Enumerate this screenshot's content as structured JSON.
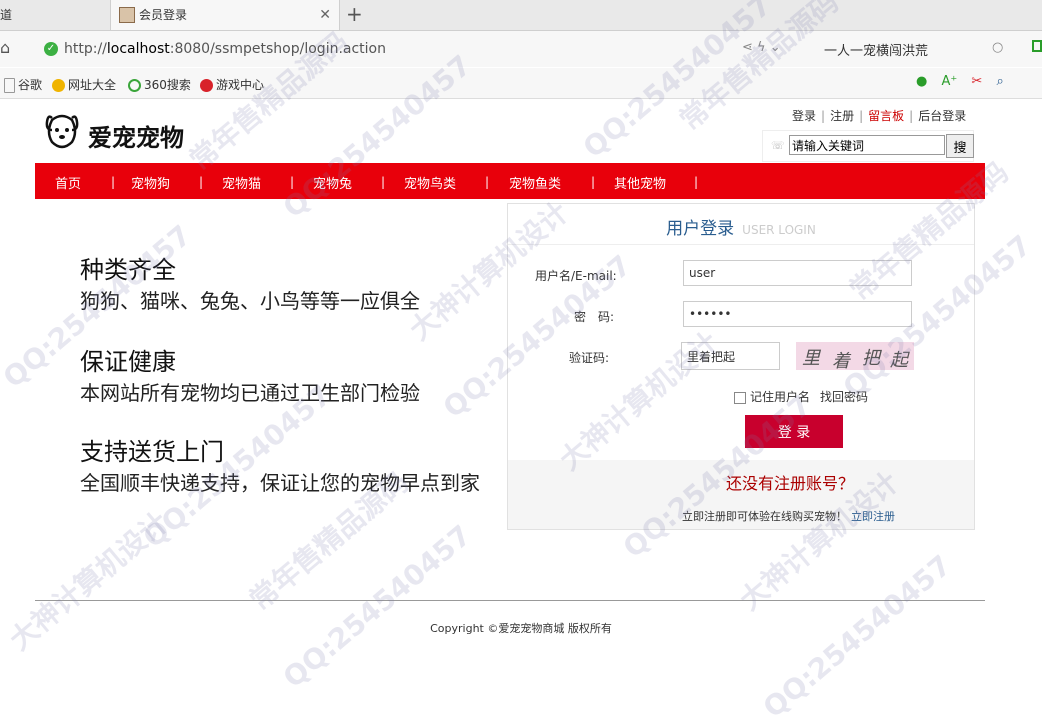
{
  "browser": {
    "prev_tab_label": "道",
    "active_tab_label": "会员登录",
    "url_prefix": "http://",
    "url_host": "localhost",
    "url_rest": ":8080/ssmpetshop/login.action",
    "side_search_text": "一人一宠横闯洪荒",
    "bookmarks": [
      {
        "label": "谷歌",
        "icon": "page-icon"
      },
      {
        "label": "网址大全",
        "icon": "sites-icon"
      },
      {
        "label": "360搜索",
        "icon": "360-icon"
      },
      {
        "label": "游戏中心",
        "icon": "game-icon"
      }
    ]
  },
  "site": {
    "name": "爱宠宠物",
    "top_links": {
      "login": "登录",
      "register": "注册",
      "guestbook": "留言板",
      "admin": "后台登录"
    },
    "search": {
      "placeholder": "请输入关键词",
      "button": "搜"
    },
    "nav": [
      "首页",
      "宠物狗",
      "宠物猫",
      "宠物兔",
      "宠物鸟类",
      "宠物鱼类",
      "其他宠物"
    ]
  },
  "features": [
    {
      "title": "种类齐全",
      "desc": "狗狗、猫咪、兔兔、小鸟等等一应俱全"
    },
    {
      "title": "保证健康",
      "desc": "本网站所有宠物均已通过卫生部门检验"
    },
    {
      "title": "支持送货上门",
      "desc": "全国顺丰快递支持，保证让您的宠物早点到家"
    }
  ],
  "login": {
    "title": "用户登录",
    "title_en": "USER LOGIN",
    "username_label": "用户名/E-mail:",
    "username_value": "user",
    "password_label": "密　码:",
    "password_value": "••••••",
    "captcha_label": "验证码:",
    "captcha_value": "里着把起",
    "captcha_chars": [
      "里",
      "着",
      "把",
      "起"
    ],
    "remember_label": "记住用户名",
    "forgot_label": "找回密码",
    "login_button": "登 录",
    "no_account": "还没有注册账号？",
    "register_hint": "立即注册即可体验在线购买宠物！",
    "register_link": "立即注册"
  },
  "footer": {
    "copyright": "Copyright ©爱宠宠物商城 版权所有"
  },
  "watermark_texts": [
    "QQ:254540457",
    "常年售精品源码",
    "大神计算机设计"
  ]
}
